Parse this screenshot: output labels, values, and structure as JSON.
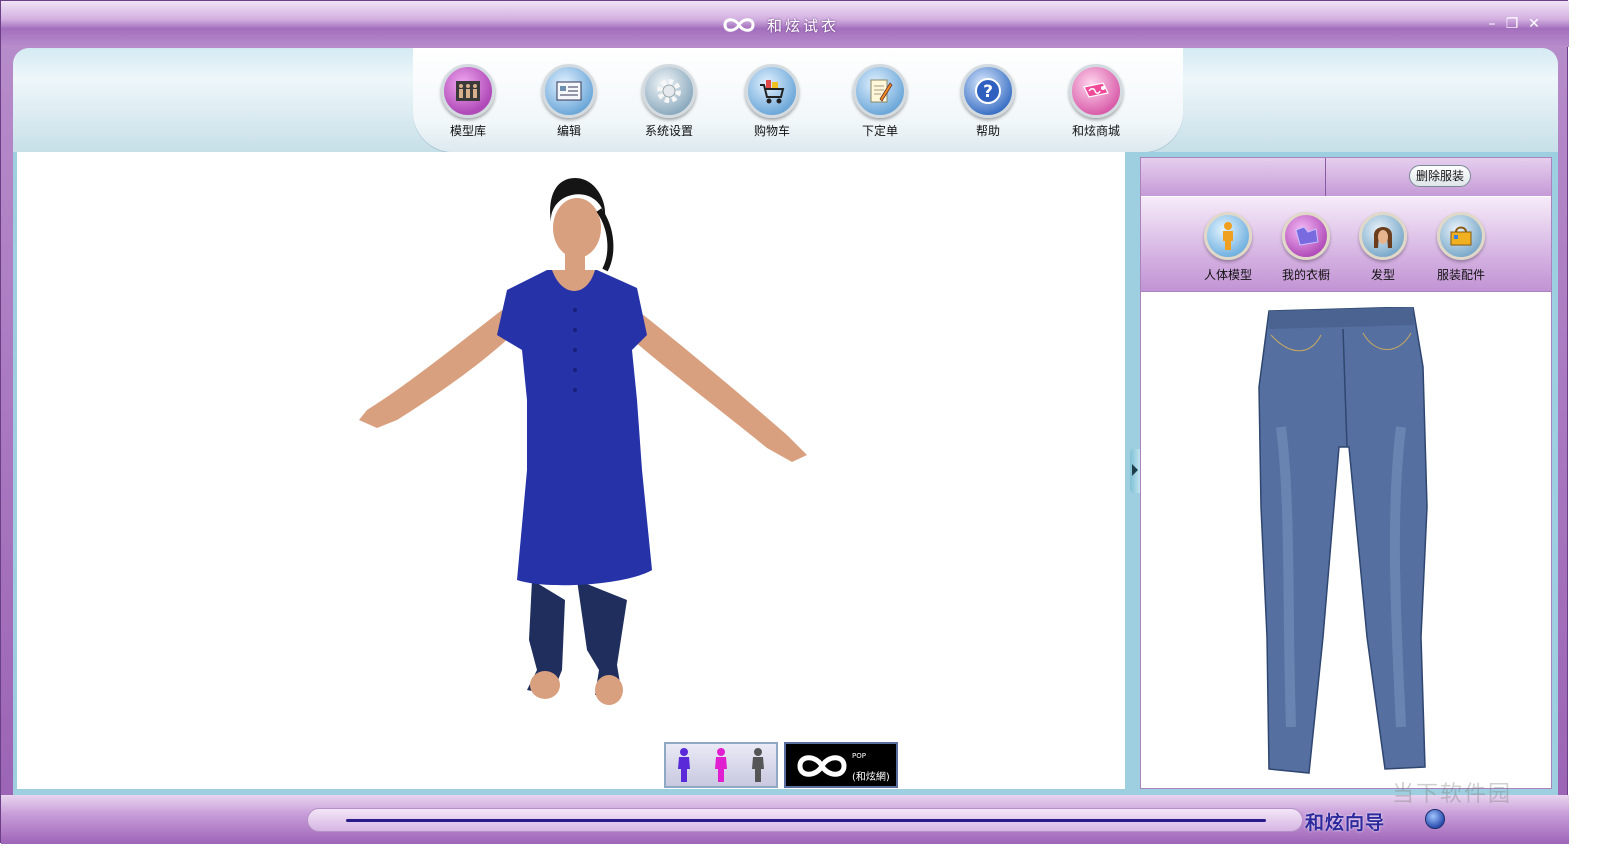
{
  "window": {
    "title": "和炫试衣",
    "controls": {
      "minimize": "–",
      "restore": "❐",
      "close": "✕"
    }
  },
  "toolbar": {
    "items": [
      {
        "label": "模型库",
        "icon": "model-library-icon",
        "color": "#b04ab8"
      },
      {
        "label": "编辑",
        "icon": "edit-icon",
        "color": "#6aa6d8"
      },
      {
        "label": "系统设置",
        "icon": "gear-icon",
        "color": "#8aa9bd"
      },
      {
        "label": "购物车",
        "icon": "shopping-cart-icon",
        "color": "#6aa6d8"
      },
      {
        "label": "下定单",
        "icon": "order-pencil-icon",
        "color": "#6aa6d8"
      },
      {
        "label": "帮助",
        "icon": "help-icon",
        "color": "#3a6fc4"
      },
      {
        "label": "和炫商城",
        "icon": "store-tag-icon",
        "color": "#d85aa8"
      }
    ]
  },
  "panel": {
    "delete_button": "删除服装",
    "tabs": [
      {
        "label": "人体模型",
        "icon": "human-model-icon",
        "color": "#6fb0e0"
      },
      {
        "label": "我的衣橱",
        "icon": "wardrobe-icon",
        "color": "#b04ab8"
      },
      {
        "label": "发型",
        "icon": "hairstyle-icon",
        "color": "#7aa9c9"
      },
      {
        "label": "服装配件",
        "icon": "accessories-icon",
        "color": "#7aa9c9"
      }
    ],
    "preview_item": "jeans-icon"
  },
  "bottom": {
    "logo_text": "(和炫網)",
    "logo_sup": "POP"
  },
  "statusbar": {
    "wizard_label": "和炫向导"
  },
  "watermark": "当下软件园"
}
